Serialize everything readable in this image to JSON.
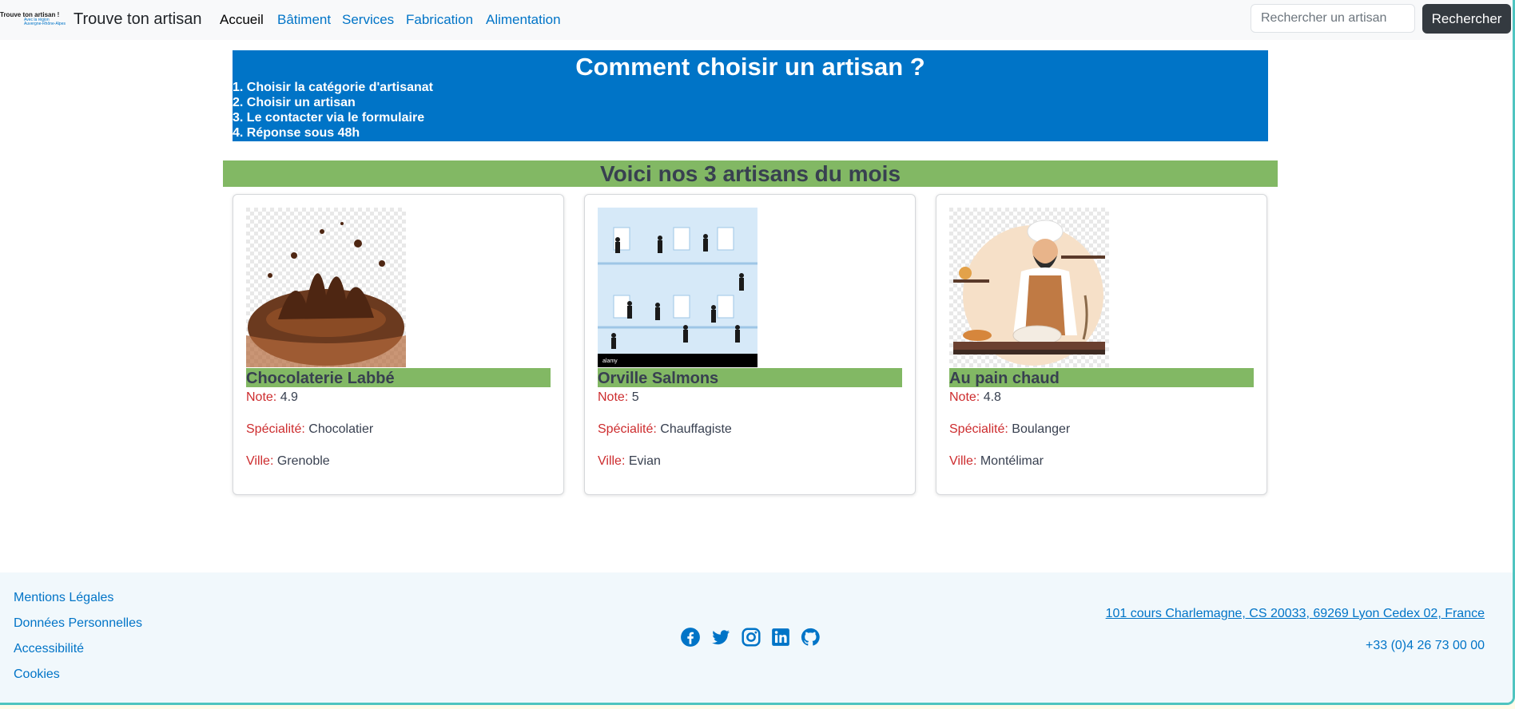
{
  "navbar": {
    "logo_text": "Trouve ton artisan !",
    "logo_sub1": "Avec la région",
    "logo_sub2": "Auvergne-Rhône-Alpes",
    "brand": "Trouve ton artisan",
    "links": [
      {
        "label": "Accueil",
        "active": true
      },
      {
        "label": "Bâtiment"
      },
      {
        "label": "Services"
      },
      {
        "label": "Fabrication"
      },
      {
        "label": "Alimentation"
      }
    ],
    "search_placeholder": "Rechercher un artisan",
    "search_button": "Rechercher"
  },
  "howto": {
    "title": "Comment choisir un artisan ?",
    "steps": [
      "1. Choisir la catégorie d'artisanat",
      "2. Choisir un artisan",
      "3. Le contacter via le formulaire",
      "4. Réponse sous 48h"
    ]
  },
  "month_title": "Voici nos 3 artisans du mois",
  "labels": {
    "note": "Note:",
    "specialite": "Spécialité:",
    "ville": "Ville:"
  },
  "artisans": [
    {
      "name": "Chocolaterie Labbé",
      "note": "4.9",
      "specialite": "Chocolatier",
      "ville": "Grenoble",
      "image": "chocolate-splash"
    },
    {
      "name": "Orville Salmons",
      "note": "5",
      "specialite": "Chauffagiste",
      "ville": "Evian",
      "image": "building-workers",
      "image_caption": "alamy"
    },
    {
      "name": "Au pain chaud",
      "note": "4.8",
      "specialite": "Boulanger",
      "ville": "Montélimar",
      "image": "baker-illustration"
    }
  ],
  "footer": {
    "links": [
      "Mentions Légales",
      "Données Personnelles",
      "Accessibilité",
      "Cookies"
    ],
    "socials": [
      "facebook-icon",
      "twitter-icon",
      "instagram-icon",
      "linkedin-icon",
      "github-icon"
    ],
    "address": "101 cours Charlemagne, CS 20033, 69269 Lyon Cedex 02, France",
    "phone": "+33 (0)4 26 73 00 00"
  },
  "colors": {
    "primary": "#0074c7",
    "green": "#82b864",
    "red": "#cd2c2e",
    "dark": "#384050"
  }
}
